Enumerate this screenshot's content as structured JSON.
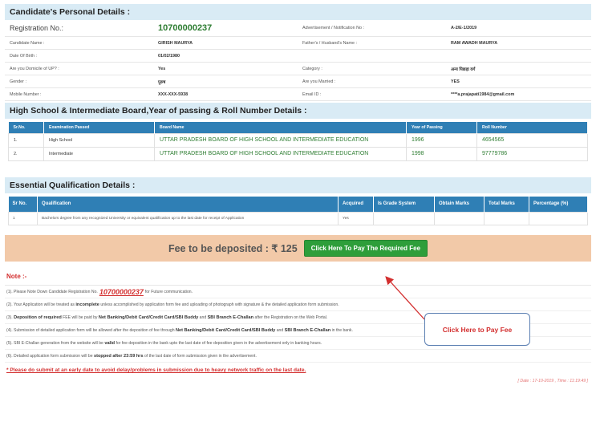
{
  "personal": {
    "heading": "Candidate's Personal Details :",
    "rows": [
      {
        "l1": "Registration No.:",
        "v1": "10700000237",
        "l2": "Advertisement / Notification No :",
        "v2": "A-2/E-1/2019"
      },
      {
        "l1": "Candidate Name :",
        "v1": "GIRISH MAURYA",
        "l2": "Father's / Husband's Name :",
        "v2": "RAM AWADH MAURYA"
      },
      {
        "l1": "Date Of Birth :",
        "v1": "01/02/1980",
        "l2": "",
        "v2": ""
      },
      {
        "l1": "Are you Domicile of UP? :",
        "v1": "Yes",
        "l2": "Category :",
        "v2": "अन्य पिछड़ा वर्ग"
      },
      {
        "l1": "Gender :",
        "v1": "पुरुष",
        "l2": "Are you Married :",
        "v2": "YES"
      },
      {
        "l1": "Mobile Number :",
        "v1": "XXX-XXX-5938",
        "l2": "Email ID :",
        "v2": "****a.prajapati1984@gmail.com"
      }
    ]
  },
  "highschool": {
    "heading": "High School & Intermediate Board,Year of passing & Roll Number Details :",
    "headers": [
      "Sr.No.",
      "Examination Passed",
      "Board Name",
      "Year of Passing",
      "Roll Number"
    ],
    "rows": [
      [
        "1.",
        "High School",
        "UTTAR PRADESH BOARD OF HIGH SCHOOL AND INTERMEDIATE EDUCATION",
        "1996",
        "4654565"
      ],
      [
        "2.",
        "Intermediate",
        "UTTAR PRADESH BOARD OF HIGH SCHOOL AND INTERMEDIATE EDUCATION",
        "1998",
        "97779786"
      ]
    ]
  },
  "qualification": {
    "heading": "Essential Qualification Details :",
    "headers": [
      "Sr No.",
      "Qualification",
      "Acquired",
      "Is Grade System",
      "Obtain Marks",
      "Total Marks",
      "Percentage (%)"
    ],
    "rows": [
      [
        "1",
        "Bachelors degree from any recognized University or equivalent qualification up to the last date for receipt of Application",
        "Yes",
        "",
        "",
        "",
        ""
      ]
    ]
  },
  "fee": {
    "text": "Fee to be deposited : ₹ 125",
    "button": "Click Here To Pay The Required Fee"
  },
  "notes": {
    "title": "Note :-",
    "n1_pre": "(1). Please Note Down Candidate Registration No.",
    "n1_reg": "10700000237",
    "n1_post": "for Future communication.",
    "n2_pre": "(2). Your Application will be treated as",
    "n2_bold": "incomplete",
    "n2_post": "unless accomplished by application form fee and uploading of photograph with signature & the detailed application form submission.",
    "n3_pre": "(3).",
    "n3_bold1": "Deposition of required",
    "n3_mid1": "FEE will be paid by",
    "n3_bold2": "Net Banking/Debit Card/Credit Card/SBI Buddy",
    "n3_mid2": "and",
    "n3_bold3": "SBI Branch E-Challan",
    "n3_post": "after the Registration on the Web Portal.",
    "n4_pre": "(4). Submission of detailed application form will be allowed after the deposition of fee through",
    "n4_bold1": "Net Banking/Debit Card/Credit Card/SBI Buddy",
    "n4_mid": "and",
    "n4_bold2": "SBI Branch E-Challan",
    "n4_post": "in the bank.",
    "n5_pre": "(5). SBI E-Challan generation from the website will be",
    "n5_bold": "valid",
    "n5_post": "for fee deposition in the bank upto the last date of fee deposition given in the advertisement only in banking hours.",
    "n6_pre": "(6). Detailed application form submission will be",
    "n6_bold": "stopped after 23:59 hrs",
    "n6_post": "of the last date of form submission given in the advertisement.",
    "warning": "* Please do submit at an early date to avoid delay/problems in submission due to heavy network traffic on the last date.",
    "date": "[ Date : 17-10-2019 , Time : 11:19:49 ]"
  },
  "callout": "Click Here to Pay Fee",
  "colors": {
    "header_bg": "#d9ebf5",
    "table_head": "#2f7fb5",
    "fee_bar": "#f2c9a8",
    "pay_button": "#2e9e3a",
    "note_red": "#d32f2f"
  }
}
